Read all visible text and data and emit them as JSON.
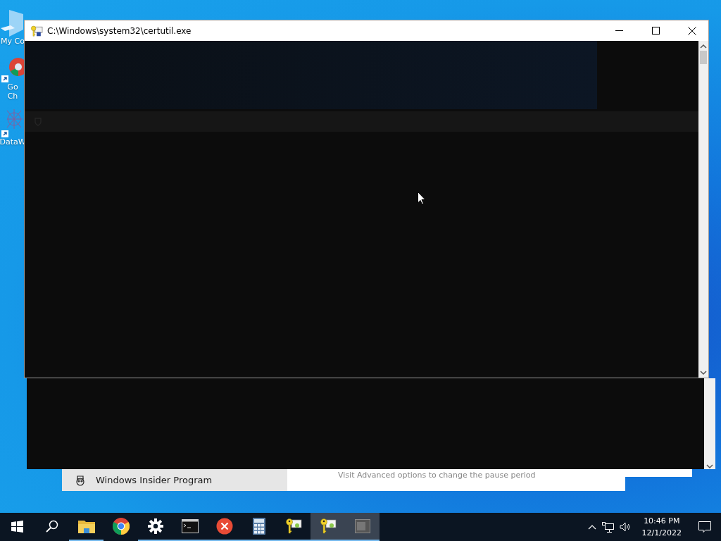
{
  "desktop_icons": [
    {
      "kind": "computer",
      "lines": [
        "My Co"
      ]
    },
    {
      "kind": "chrome",
      "lines": [
        "Go",
        "Ch"
      ]
    },
    {
      "kind": "datawindow",
      "lines": [
        "DataW"
      ]
    }
  ],
  "settings_window": {
    "nav_item": "Windows Insider Program",
    "hint": "Visit Advanced options to change the pause period"
  },
  "console_window": {
    "title": "C:\\Windows\\system32\\certutil.exe"
  },
  "taskbar": {
    "items": [
      {
        "kind": "start",
        "running": false,
        "highlighted": false
      },
      {
        "kind": "search",
        "running": false,
        "highlighted": false
      },
      {
        "kind": "folder",
        "running": true,
        "highlighted": false
      },
      {
        "kind": "chrome",
        "running": false,
        "highlighted": false
      },
      {
        "kind": "gear",
        "running": true,
        "highlighted": false
      },
      {
        "kind": "terminal",
        "running": true,
        "highlighted": false
      },
      {
        "kind": "error",
        "running": true,
        "highlighted": false
      },
      {
        "kind": "calculator",
        "running": true,
        "highlighted": false
      },
      {
        "kind": "keycert",
        "running": true,
        "highlighted": false
      },
      {
        "kind": "keycert",
        "running": true,
        "highlighted": true
      },
      {
        "kind": "window",
        "running": true,
        "highlighted": true
      }
    ],
    "time": "10:46 PM",
    "date": "12/1/2022"
  }
}
